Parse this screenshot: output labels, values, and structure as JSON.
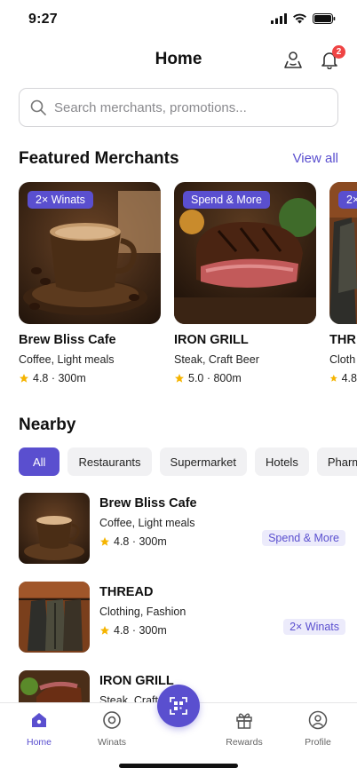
{
  "status": {
    "time": "9:27"
  },
  "header": {
    "title": "Home",
    "notification_count": "2"
  },
  "search": {
    "placeholder": "Search merchants, promotions..."
  },
  "featured": {
    "title": "Featured Merchants",
    "view_all": "View all",
    "cards": [
      {
        "promo": "2× Winats",
        "name": "Brew Bliss Cafe",
        "category": "Coffee, Light meals",
        "rating": "4.8 · 300m"
      },
      {
        "promo": "Spend & More",
        "name": "IRON GRILL",
        "category": "Steak, Craft Beer",
        "rating": "5.0 · 800m"
      },
      {
        "promo": "2×",
        "name": "THR",
        "category": "Cloth",
        "rating": "4.8"
      }
    ]
  },
  "nearby": {
    "title": "Nearby",
    "chips": [
      "All",
      "Restaurants",
      "Supermarket",
      "Hotels",
      "Pharm"
    ],
    "items": [
      {
        "name": "Brew Bliss Cafe",
        "category": "Coffee, Light meals",
        "rating": "4.8 · 300m",
        "promo": "Spend & More"
      },
      {
        "name": "THREAD",
        "category": "Clothing, Fashion",
        "rating": "4.8 · 300m",
        "promo": "2× Winats"
      },
      {
        "name": "IRON GRILL",
        "category": "Steak, Craft",
        "rating": "",
        "promo": ""
      }
    ]
  },
  "nav": {
    "home": "Home",
    "winats": "Winats",
    "rewards": "Rewards",
    "profile": "Profile"
  },
  "colors": {
    "accent": "#5a4fcf",
    "star": "#f5b400",
    "badge": "#ef4444"
  }
}
